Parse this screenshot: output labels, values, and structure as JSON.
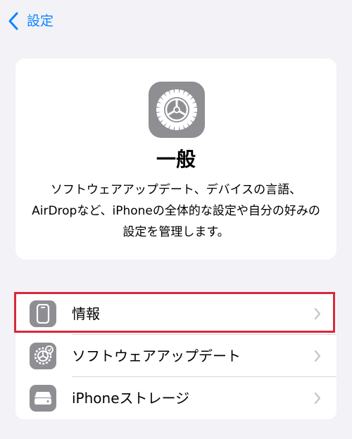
{
  "nav": {
    "back_label": "設定"
  },
  "hero": {
    "icon": "gear-icon",
    "title": "一般",
    "description": "ソフトウェアアップデート、デバイスの言語、AirDropなど、iPhoneの全体的な設定や自分の好みの設定を管理します。"
  },
  "list": {
    "items": [
      {
        "label": "情報",
        "icon": "iphone-icon"
      },
      {
        "label": "ソフトウェアアップデート",
        "icon": "gear-update-icon"
      },
      {
        "label": "iPhoneストレージ",
        "icon": "storage-icon"
      }
    ]
  },
  "colors": {
    "accent": "#0a84ff",
    "background": "#f2f2f7",
    "icon_gray": "#8e8e93",
    "highlight": "#d9283a"
  }
}
